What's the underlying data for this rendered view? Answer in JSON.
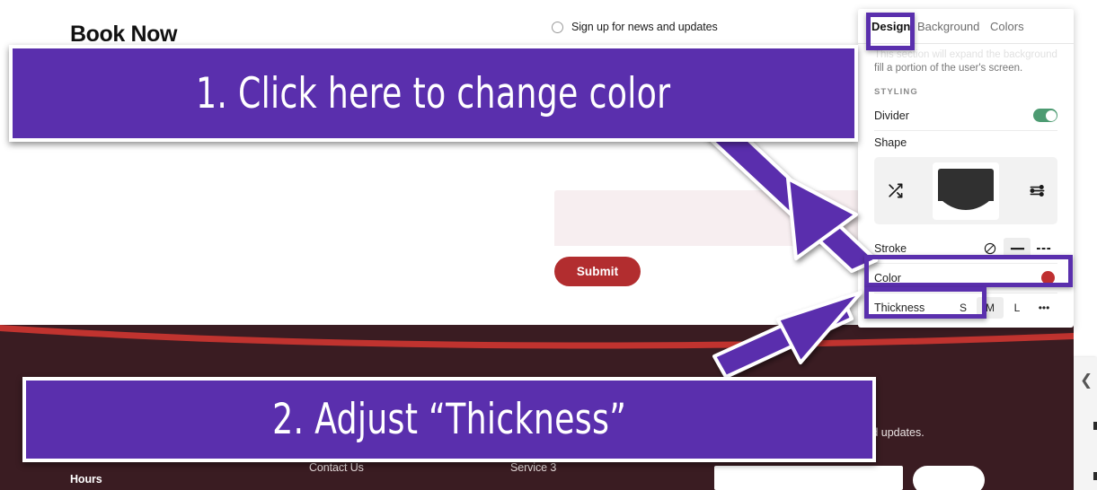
{
  "site": {
    "logo": "Book Now",
    "newsletter_checkbox_label": "Sign up for news and updates",
    "submit_button": "Submit",
    "footer": {
      "col_hours": "Hours",
      "col_contact": "Contact Us",
      "col_service": "Service 3",
      "note": "receive news and updates."
    }
  },
  "panel": {
    "tabs": [
      {
        "label": "Design",
        "active": true
      },
      {
        "label": "Background",
        "active": false
      },
      {
        "label": "Colors",
        "active": false
      }
    ],
    "description_faded": "This section will expand the background height to",
    "description": "fill a portion of the user's screen.",
    "section_label": "STYLING",
    "divider_row_label": "Divider",
    "divider_toggle_state": "on",
    "shape_label": "Shape",
    "shape_shuffle_icon": "shuffle-icon",
    "shape_settings_icon": "sliders-icon",
    "stroke_row_label": "Stroke",
    "stroke_options": [
      "none",
      "solid",
      "dashed"
    ],
    "stroke_selected": "solid",
    "color_row_label": "Color",
    "color_swatch_hex": "#bf2f31",
    "thickness_row_label": "Thickness",
    "thickness_options": [
      "S",
      "M",
      "L",
      "•••"
    ],
    "thickness_selected": "M"
  },
  "annotations": {
    "step1": "1. Click here to change color",
    "step2": "2. Adjust “Thickness”",
    "highlight_color": "#5a2fad",
    "arrow_color": "#5a2fad"
  },
  "collapse_handle": {
    "icon": "chevron-left-icon"
  }
}
